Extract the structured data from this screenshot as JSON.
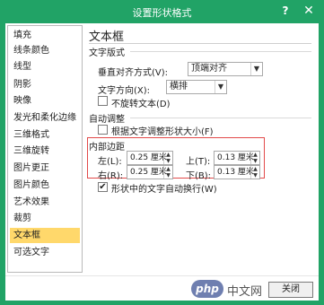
{
  "window": {
    "title": "设置形状格式",
    "help_glyph": "?",
    "close_glyph": "✕"
  },
  "sidebar": {
    "items": [
      {
        "label": "填充"
      },
      {
        "label": "线条颜色"
      },
      {
        "label": "线型"
      },
      {
        "label": "阴影"
      },
      {
        "label": "映像"
      },
      {
        "label": "发光和柔化边缘"
      },
      {
        "label": "三维格式"
      },
      {
        "label": "三维旋转"
      },
      {
        "label": "图片更正"
      },
      {
        "label": "图片颜色"
      },
      {
        "label": "艺术效果"
      },
      {
        "label": "裁剪"
      },
      {
        "label": "文本框"
      },
      {
        "label": "可选文字"
      }
    ],
    "active_index": 12
  },
  "panel": {
    "title": "文本框",
    "text_layout": {
      "heading": "文字版式",
      "vertical_align_label": "垂直对齐方式(V):",
      "vertical_align_value": "顶端对齐",
      "text_direction_label": "文字方向(X):",
      "text_direction_value": "横排",
      "no_rotate_label": "不旋转文本(D)"
    },
    "autofit": {
      "heading": "自动调整",
      "resize_label": "根据文字调整形状大小(F)"
    },
    "internal_margin": {
      "heading": "内部边距",
      "left_label": "左(L):",
      "left_value": "0.25 厘米",
      "top_label": "上(T):",
      "top_value": "0.13 厘米",
      "right_label": "右(R):",
      "right_value": "0.25 厘米",
      "bottom_label": "下(B):",
      "bottom_value": "0.13 厘米"
    },
    "wrap_label": "形状中的文字自动换行(W)",
    "wrap_checked": true,
    "check_glyph": "✔"
  },
  "footer": {
    "close_label": "关闭",
    "watermark_logo": "php",
    "watermark_text": "中文网"
  },
  "glyphs": {
    "dropdown": "▼",
    "spin_up": "▲",
    "spin_down": "▼"
  },
  "colors": {
    "titlebar": "#21a366",
    "active_item": "#ffd86b",
    "highlight_box": "#e24a4a"
  }
}
